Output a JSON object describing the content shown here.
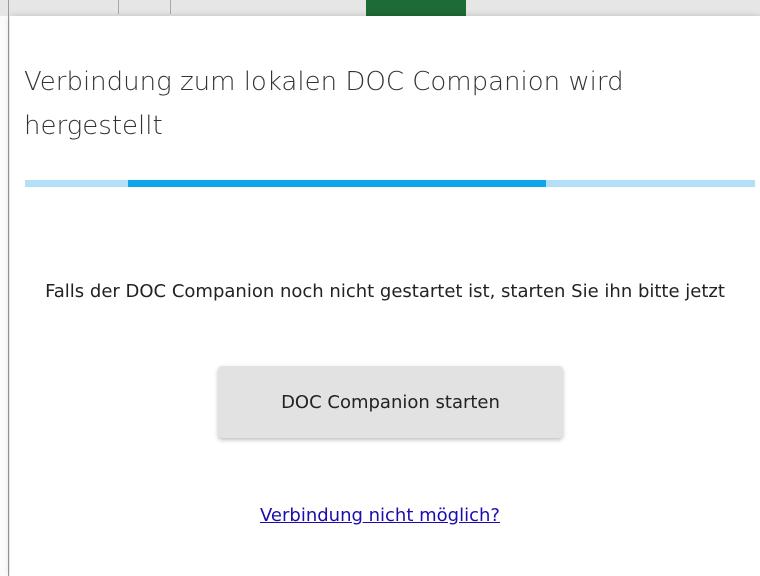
{
  "dialog": {
    "title": "Verbindung zum lokalen DOC Companion wird hergestellt",
    "progress_percent": 57,
    "message": "Falls der DOC Companion noch nicht gestartet ist, starten Sie ihn bitte jetzt",
    "start_button_label": "DOC Companion starten",
    "help_link_label": "Verbindung nicht möglich?"
  },
  "colors": {
    "progress_track": "#b3e0f9",
    "progress_fill": "#0ea5ea",
    "link": "#1a0dab",
    "background_accent": "#1e6b35"
  }
}
